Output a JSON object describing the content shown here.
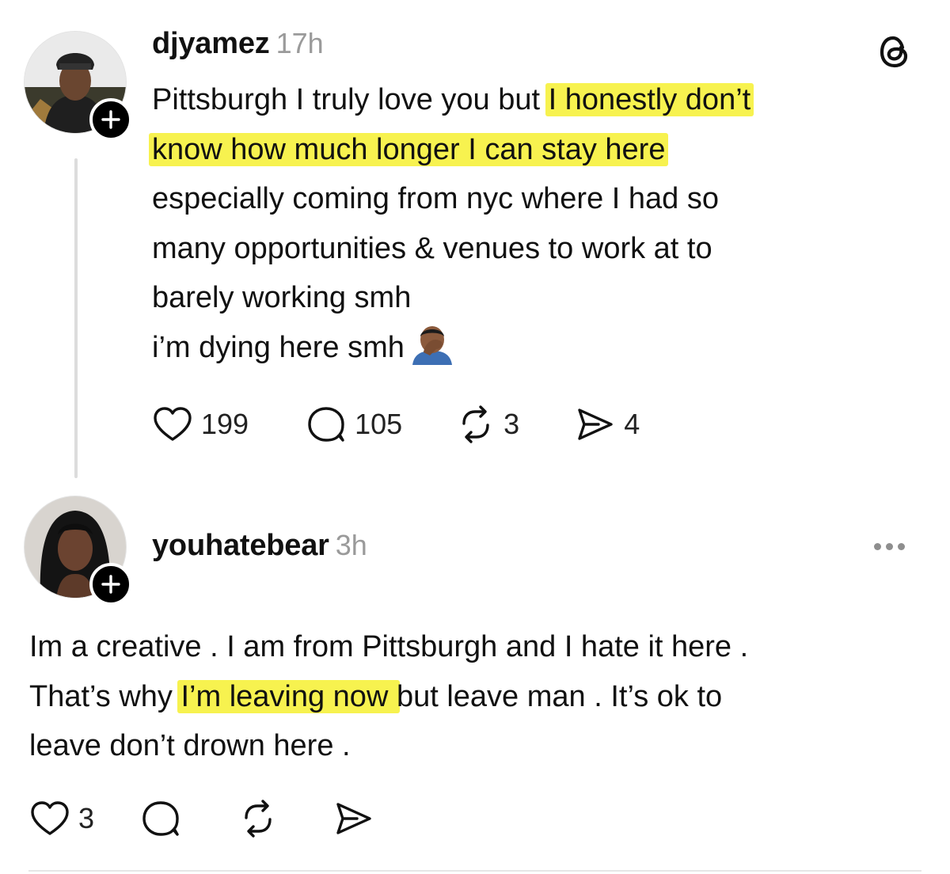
{
  "posts": [
    {
      "username": "djyamez",
      "time": "17h",
      "lines": [
        {
          "pre": "Pittsburgh I truly love you but ",
          "highlight": "I honestly don’t"
        },
        {
          "pre": "",
          "highlight": "know how much longer I can stay here"
        },
        {
          "pre": "especially coming from nyc where I had so",
          "highlight": ""
        },
        {
          "pre": "many opportunities & venues to work at to",
          "highlight": ""
        },
        {
          "pre": "barely working smh",
          "highlight": ""
        },
        {
          "pre": "i’m dying here smh",
          "highlight": ""
        }
      ],
      "emoji": "person-facepalming",
      "likes": "199",
      "replies": "105",
      "reposts": "3",
      "shares": "4"
    },
    {
      "username": "youhatebear",
      "time": "3h",
      "line1": "Im a creative . I am from Pittsburgh and I hate it here .",
      "line2_pre": "That’s why ",
      "line2_highlight": "I’m leaving now ",
      "line2_post": "but leave man . It’s ok to",
      "line3": "leave don’t drown here .",
      "likes": "3"
    }
  ],
  "icons": {
    "app_logo": "threads-logo-icon",
    "more": "more-options-icon",
    "like": "heart-icon",
    "reply": "comment-icon",
    "repost": "repost-icon",
    "share": "send-icon",
    "follow": "plus-icon"
  },
  "colors": {
    "highlight": "#f7f24f",
    "muted": "#9a9a9a",
    "text": "#111111"
  }
}
